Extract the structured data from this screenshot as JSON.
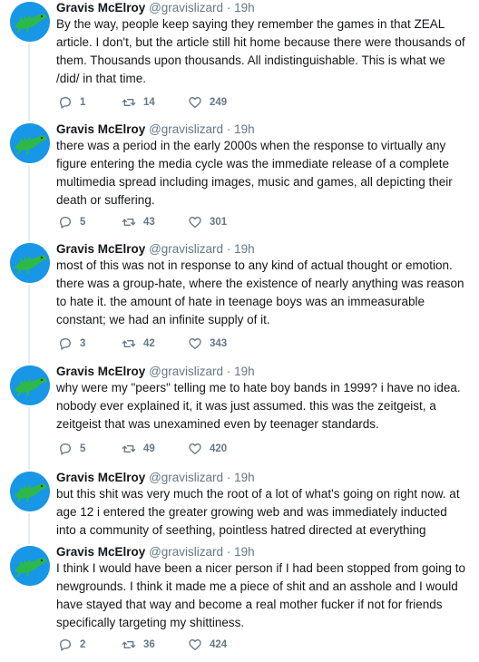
{
  "tweets": [
    {
      "name": "Gravis McElroy",
      "handle": "@gravislizard",
      "separator": "·",
      "time": "19h",
      "text": "By the way, people keep saying they remember the games in that ZEAL article. I don't, but the article still hit home because there were thousands of them. Thousands upon thousands. All indistinguishable. This is what we /did/ in that time.",
      "replies": "1",
      "retweets": "14",
      "likes": "249"
    },
    {
      "name": "Gravis McElroy",
      "handle": "@gravislizard",
      "separator": "·",
      "time": "19h",
      "text": "there was a period in the early 2000s when the response to virtually any figure entering the media cycle was the immediate release of a complete multimedia spread including images, music and games, all depicting their death or suffering.",
      "replies": "5",
      "retweets": "43",
      "likes": "301"
    },
    {
      "name": "Gravis McElroy",
      "handle": "@gravislizard",
      "separator": "·",
      "time": "19h",
      "text": "most of this was not in response to any kind of actual thought or emotion. there was a group-hate, where the existence of nearly anything was reason to hate it. the amount of hate in teenage boys was an immeasurable constant; we had an infinite supply of it.",
      "replies": "3",
      "retweets": "42",
      "likes": "343"
    },
    {
      "name": "Gravis McElroy",
      "handle": "@gravislizard",
      "separator": "·",
      "time": "19h",
      "text": "why were my \"peers\" telling me to hate boy bands in 1999? i have no idea. nobody ever explained it, it was just assumed. this was the zeitgeist, a zeitgeist that was unexamined even by teenager standards.",
      "replies": "5",
      "retweets": "49",
      "likes": "420"
    },
    {
      "name": "Gravis McElroy",
      "handle": "@gravislizard",
      "separator": "·",
      "time": "19h",
      "text": "but this shit was very much the root of a lot of what's going on right now. at age 12 i entered the greater growing web and was immediately inducted into a community of seething, pointless hatred directed at everything"
    },
    {
      "name": "Gravis McElroy",
      "handle": "@gravislizard",
      "separator": "·",
      "time": "19h",
      "text": "I think I would have been a nicer person if I had been stopped from going to newgrounds. I think it made me a piece of shit and an asshole and I would have stayed that way and become a real mother fucker if not for friends specifically targeting my shittiness.",
      "replies": "2",
      "retweets": "36",
      "likes": "424"
    }
  ],
  "icons": {
    "avatar": "green-lizard-avatar",
    "reply": "reply-icon",
    "retweet": "retweet-icon",
    "like": "heart-icon"
  },
  "colors": {
    "avatar_bg": "#1797e6",
    "lizard": "#2fb84a",
    "muted": "#657786",
    "thread_line": "#e6ecf0"
  }
}
